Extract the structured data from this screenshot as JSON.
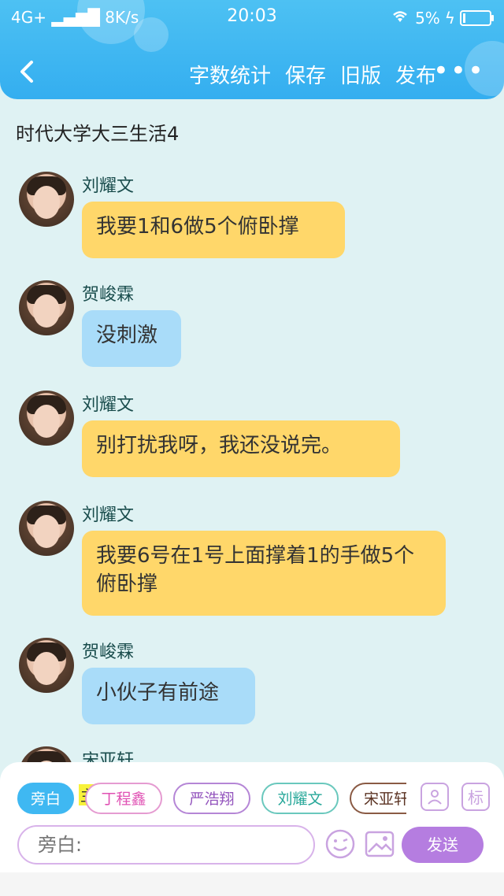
{
  "status_bar": {
    "network": "4G+",
    "speed": "8K/s",
    "time": "20:03",
    "battery": "5%"
  },
  "toolbar": {
    "back_icon": "chevron-left-icon",
    "items": [
      "字数统计",
      "保存",
      "旧版",
      "发布"
    ],
    "more": "•••"
  },
  "document": {
    "title": "时代大学大三生活4"
  },
  "messages": [
    {
      "name": "刘耀文",
      "text": "我要1和6做5个俯卧撑",
      "color": "yellow"
    },
    {
      "name": "贺峻霖",
      "text": "没刺激",
      "color": "blue"
    },
    {
      "name": "刘耀文",
      "text": "别打扰我呀，我还没说完。",
      "color": "yellow"
    },
    {
      "name": "刘耀文",
      "text": "我要6号在1号上面撑着1的手做5个俯卧撑",
      "color": "yellow"
    },
    {
      "name": "贺峻霖",
      "text": "小伙子有前途",
      "color": "blue"
    },
    {
      "name": "宋亚轩",
      "text": "",
      "color": "none"
    }
  ],
  "composer": {
    "roles": [
      "旁白",
      "丁程鑫",
      "严浩翔",
      "刘耀文",
      "宋亚轩"
    ],
    "main_mark": "主",
    "tag_button": "标",
    "input_placeholder": "旁白:",
    "send_label": "发送"
  }
}
